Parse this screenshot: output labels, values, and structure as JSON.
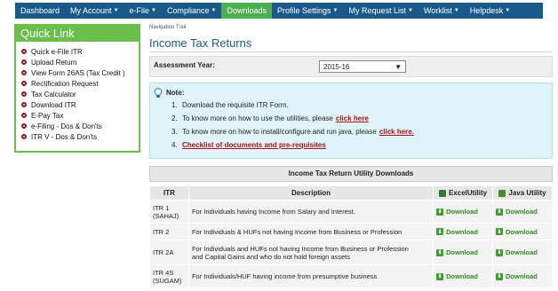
{
  "topnav": {
    "items": [
      {
        "label": "Dashboard",
        "caret": false,
        "active": false
      },
      {
        "label": "My Account",
        "caret": true,
        "active": false
      },
      {
        "label": "e-File",
        "caret": true,
        "active": false
      },
      {
        "label": "Compliance",
        "caret": true,
        "active": false
      },
      {
        "label": "Downloads",
        "caret": false,
        "active": true
      },
      {
        "label": "Profile Settings",
        "caret": true,
        "active": false
      },
      {
        "label": "My Request List",
        "caret": true,
        "active": false
      },
      {
        "label": "Worklist",
        "caret": true,
        "active": false
      },
      {
        "label": "Helpdesk",
        "caret": true,
        "active": false
      }
    ]
  },
  "quick_link": {
    "title": "Quick Link",
    "items": [
      "Quick e-File ITR",
      "Upload Return",
      "View Form 26AS (Tax Credit )",
      "Rectification Request",
      "Tax Calculator",
      "Download ITR",
      "E-Pay Tax",
      "e-Filing - Dos & Don'ts",
      "ITR V - Dos & Don'ts"
    ]
  },
  "main": {
    "nav_trail": "Navigation Trail",
    "page_title": "Income Tax Returns",
    "assessment_year": {
      "label": "Assessment Year:",
      "selected": "2015-16"
    },
    "note": {
      "title": "Note:",
      "items": [
        {
          "num": "1.",
          "text": "Download the requisite ITR Form.",
          "link": ""
        },
        {
          "num": "2.",
          "text": "To know more on how to use the utilities, please",
          "link": "click here"
        },
        {
          "num": "3.",
          "text": "To know more on how to install/configure and run java, please",
          "link": "click here."
        },
        {
          "num": "4.",
          "text": "",
          "link": "Checklist of documents and pre-requisites"
        }
      ]
    },
    "utility": {
      "heading": "Income Tax Return Utility Downloads",
      "columns": {
        "itr": "ITR",
        "desc": "Description",
        "excel": "ExcelUtility",
        "java": "Java Utility"
      },
      "download_label": "Download",
      "rows": [
        {
          "itr": [
            "ITR 1",
            "(SAHAJ)"
          ],
          "desc": [
            "For Individuals having Income from Salary and Interest."
          ]
        },
        {
          "itr": [
            "ITR 2"
          ],
          "desc": [
            "For Individuals & HUFs not having Income from Business or Profession"
          ]
        },
        {
          "itr": [
            "ITR 2A"
          ],
          "desc": [
            "For Individuals and HUFs not having Income from Business or Profession",
            "and Capital Gains and who do not hold foreign assets"
          ]
        },
        {
          "itr": [
            "ITR 4S",
            "(SUGAM)"
          ],
          "desc": [
            "For Individuals/HUF having income from presumptive business"
          ]
        }
      ]
    }
  },
  "colors": {
    "nav_bg": "#1a5a8a",
    "active": "#4caf50",
    "quick_green": "#6abf4b",
    "link_red": "#aa1111"
  }
}
